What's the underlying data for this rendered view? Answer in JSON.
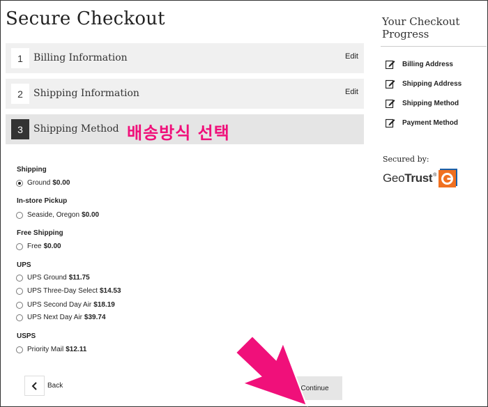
{
  "title": "Secure Checkout",
  "steps": [
    {
      "num": "1",
      "label": "Billing Information",
      "edit": "Edit"
    },
    {
      "num": "2",
      "label": "Shipping Information",
      "edit": "Edit"
    },
    {
      "num": "3",
      "label": "Shipping Method"
    }
  ],
  "annotation": "배송방식 선택",
  "shipping_groups": [
    {
      "title": "Shipping",
      "options": [
        {
          "name": "Ground",
          "price": "$0.00",
          "selected": true
        }
      ]
    },
    {
      "title": "In-store Pickup",
      "options": [
        {
          "name": "Seaside, Oregon",
          "price": "$0.00"
        }
      ]
    },
    {
      "title": "Free Shipping",
      "options": [
        {
          "name": "Free",
          "price": "$0.00"
        }
      ]
    },
    {
      "title": "UPS",
      "options": [
        {
          "name": "UPS Ground",
          "price": "$11.75"
        },
        {
          "name": "UPS Three-Day Select",
          "price": "$14.53"
        },
        {
          "name": "UPS Second Day Air",
          "price": "$18.19"
        },
        {
          "name": "UPS Next Day Air",
          "price": "$39.74"
        }
      ]
    },
    {
      "title": "USPS",
      "options": [
        {
          "name": "Priority Mail",
          "price": "$12.11"
        }
      ]
    }
  ],
  "buttons": {
    "back": "Back",
    "continue": "Continue"
  },
  "sidebar": {
    "title": "Your Checkout Progress",
    "items": [
      "Billing Address",
      "Shipping Address",
      "Shipping Method",
      "Payment Method"
    ],
    "secured_by": "Secured by:",
    "geotrust_word_1": "Geo",
    "geotrust_word_2": "Trust",
    "geotrust_reg": "®"
  },
  "colors": {
    "annotation": "#f0107a",
    "arrow": "#f0107a",
    "active_step_num": "#333333",
    "geotrust_orange": "#f07020",
    "geotrust_blue": "#1a5fa8"
  }
}
